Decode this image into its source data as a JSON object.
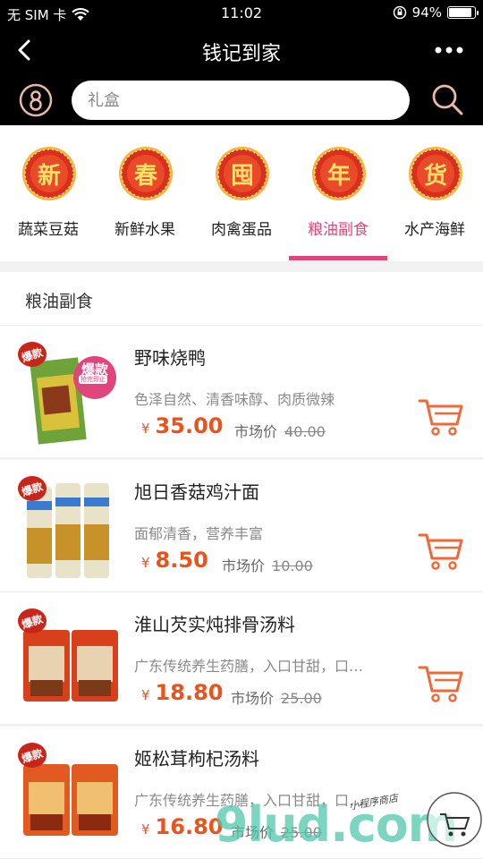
{
  "status_bar": {
    "carrier": "无 SIM 卡",
    "time": "11:02",
    "battery_percent": "94%",
    "battery_level": 0.94
  },
  "nav": {
    "title": "钱记到家"
  },
  "search": {
    "placeholder": "礼盒"
  },
  "categories": [
    {
      "badge_char": "新",
      "label": "蔬菜豆菇"
    },
    {
      "badge_char": "春",
      "label": "新鲜水果"
    },
    {
      "badge_char": "囤",
      "label": "肉禽蛋品"
    },
    {
      "badge_char": "年",
      "label": "粮油副食"
    },
    {
      "badge_char": "货",
      "label": "水产海鲜"
    }
  ],
  "active_category_index": 3,
  "section": {
    "title": "粮油副食"
  },
  "products": [
    {
      "name": "野味烧鸭",
      "desc": "色泽自然、清香味醇、肉质微辣",
      "currency": "¥",
      "price": "35.00",
      "market_label": "市场价",
      "market_price": "40.00",
      "tag": "爆款",
      "tag2": "爆款",
      "tag2_sub": "抢完即止"
    },
    {
      "name": "旭日香菇鸡汁面",
      "desc": "面郁清香，营养丰富",
      "currency": "¥",
      "price": "8.50",
      "market_label": "市场价",
      "market_price": "10.00",
      "tag": "爆款"
    },
    {
      "name": "淮山芡实炖排骨汤料",
      "desc": "广东传统养生药膳，入口甘甜，口…",
      "currency": "¥",
      "price": "18.80",
      "market_label": "市场价",
      "market_price": "25.00",
      "tag": "爆款"
    },
    {
      "name": "姬松茸枸杞汤料",
      "desc": "广东传统养生药膳，入口甘甜，口…",
      "currency": "¥",
      "price": "16.80",
      "market_label": "市场价",
      "market_price": "25.00",
      "tag": "爆款"
    }
  ],
  "watermark": {
    "text": "9lud.com",
    "handwriting": "小程序商店"
  },
  "colors": {
    "accent": "#e0457b",
    "price": "#e8541b",
    "badge_red": "#d8301c",
    "badge_gold": "#f3b43a",
    "header_bg": "#000000"
  }
}
